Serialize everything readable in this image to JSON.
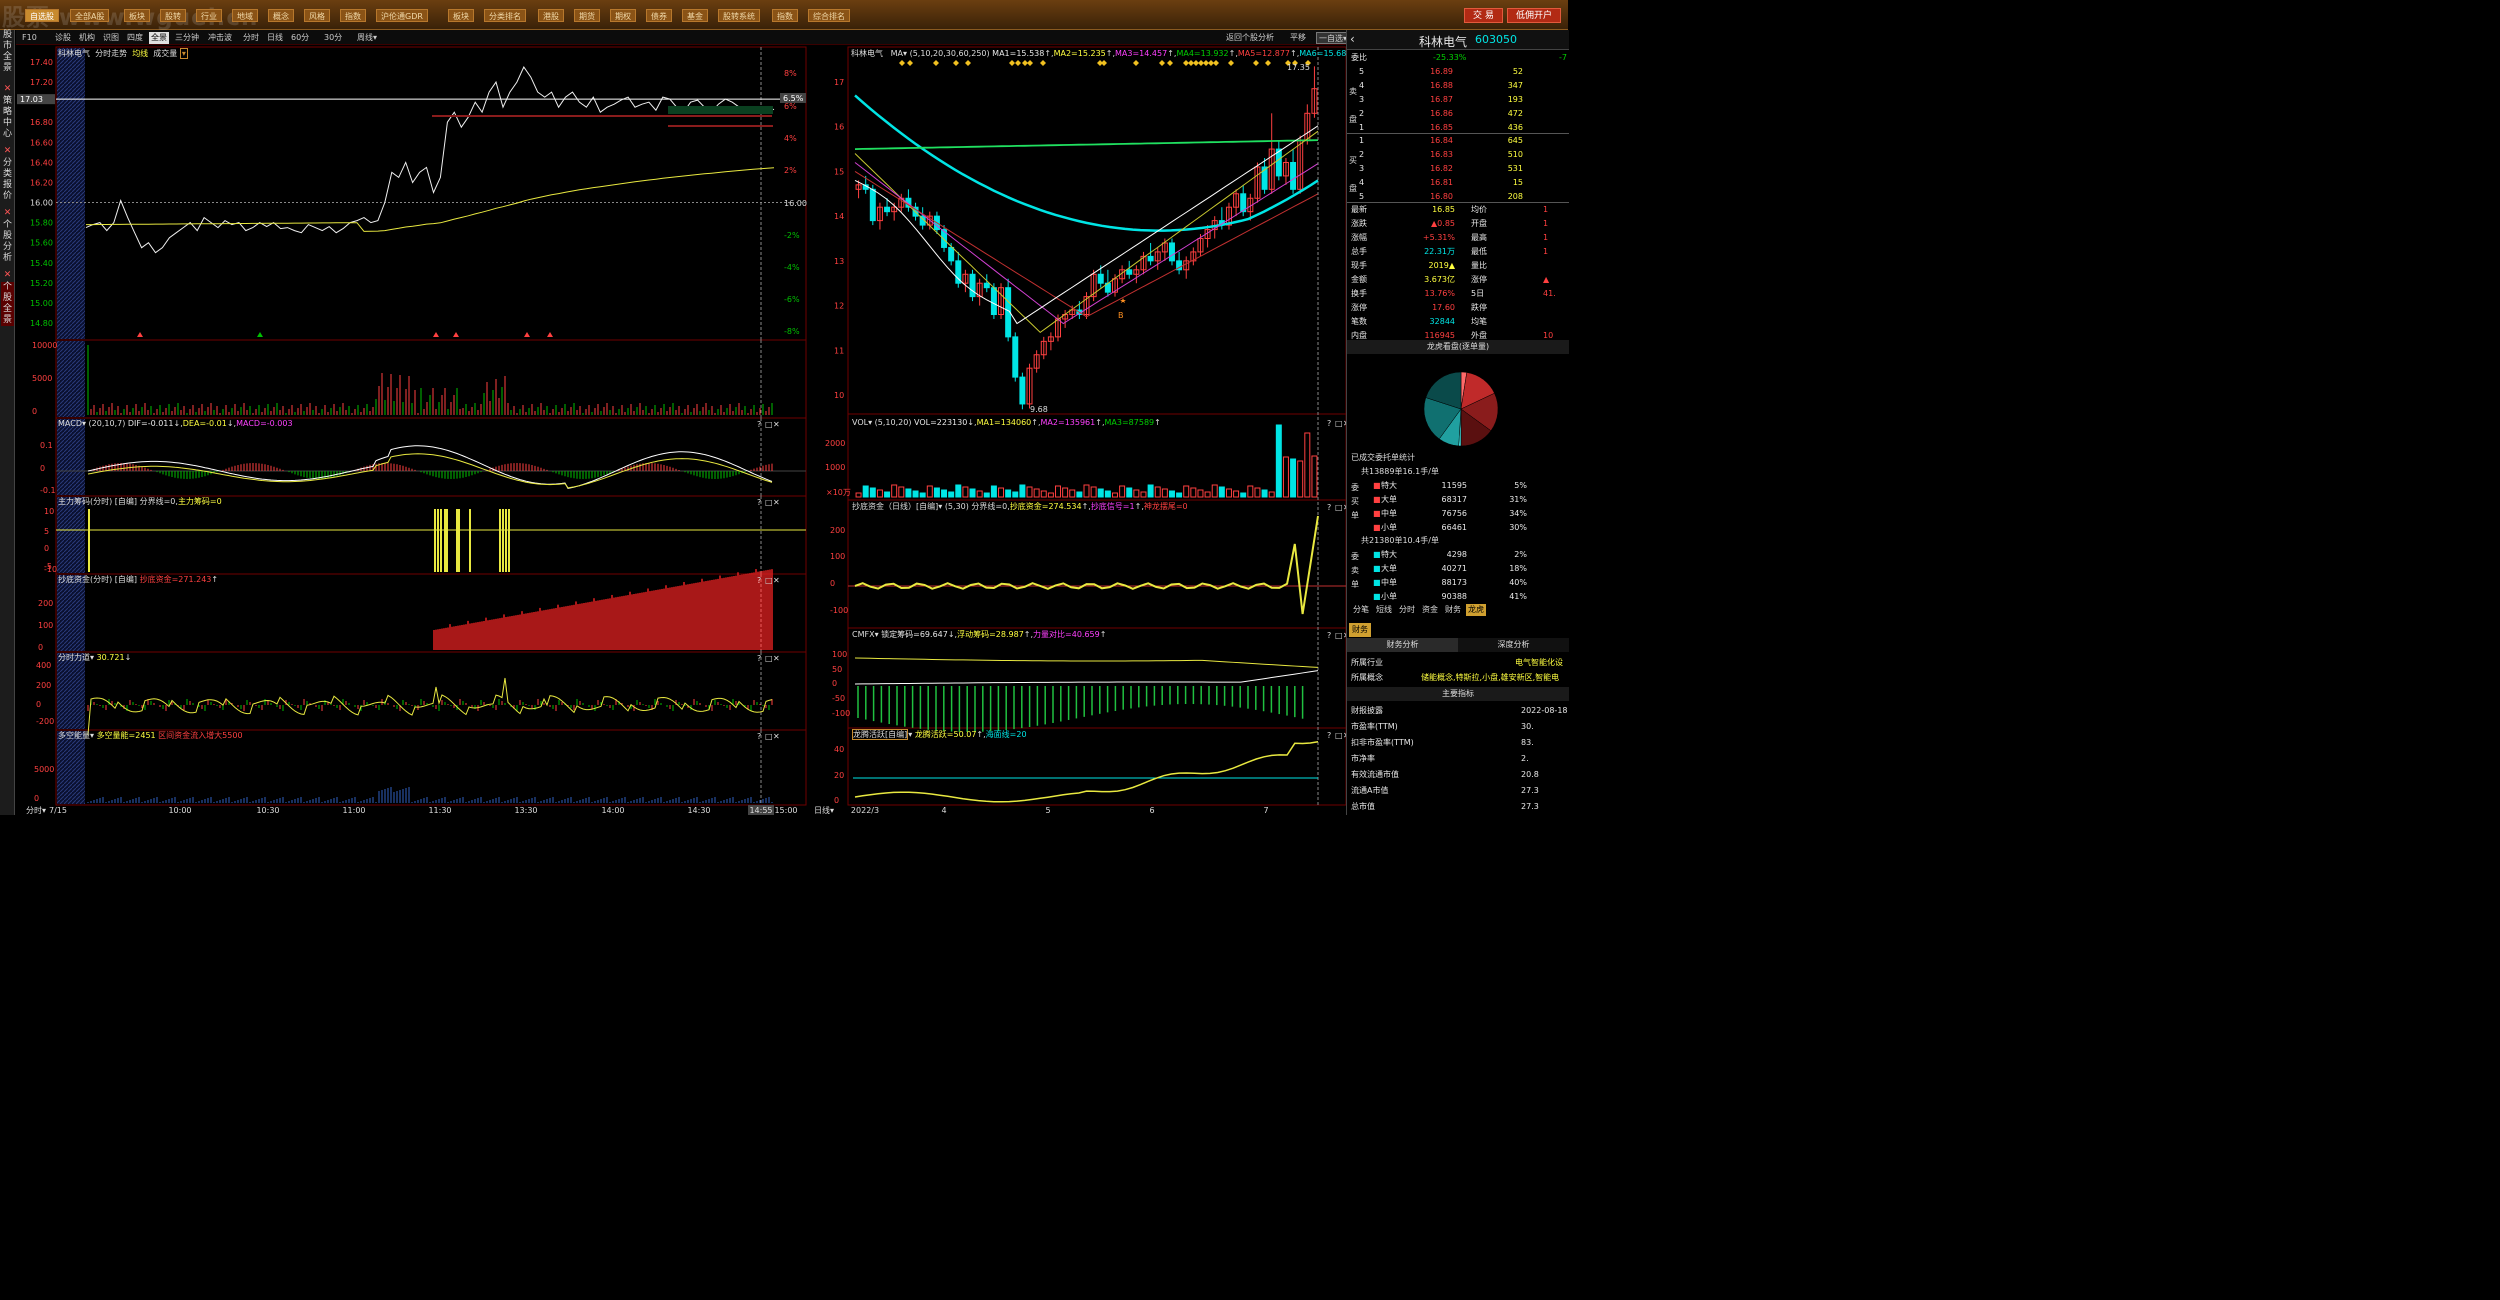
{
  "watermark": "股票 www.wguei.cn",
  "topnav": {
    "buttons": [
      "自选股",
      "全部A股",
      "板块",
      "股转",
      "行业",
      "地域",
      "概念",
      "风格",
      "指数",
      "沪伦通GDR",
      "板块",
      "分类排名",
      "港股",
      "期货",
      "期权",
      "债券",
      "基金",
      "股转系统",
      "指数",
      "综合排名"
    ],
    "trade": "交 易",
    "open_account": "低佣开户"
  },
  "sidebar": [
    "股市全景",
    "策略中心",
    "分类报价",
    "个股分析",
    "个股全景"
  ],
  "tabs": [
    "F10",
    "诊股",
    "机构",
    "识图",
    "四度",
    "全景",
    "三分钟",
    "冲击波",
    "分时",
    "日线",
    "60分",
    "30分",
    "周线▾"
  ],
  "tab_right": [
    "返回个股分析",
    "平移",
    "一自选▾"
  ],
  "intraday": {
    "title": "科林电气",
    "label": "分时走势",
    "avg": "均线",
    "vol": "成交量",
    "left_ticks": [
      "17.40",
      "17.20",
      "17.03",
      "16.80",
      "16.60",
      "16.40",
      "16.20",
      "16.00",
      "15.80",
      "15.60",
      "15.40",
      "15.20",
      "15.00",
      "14.80"
    ],
    "right_ticks": [
      "8%",
      "6.5%",
      "6%",
      "4%",
      "2%",
      "16.00",
      "-2%",
      "-4%",
      "-6%",
      "-8%"
    ],
    "price_series": [
      15.75,
      15.78,
      15.8,
      15.72,
      15.8,
      16.02,
      15.85,
      15.7,
      15.55,
      15.6,
      15.5,
      15.55,
      15.65,
      15.7,
      15.75,
      15.8,
      15.72,
      15.85,
      15.8,
      15.75,
      15.82,
      15.78,
      15.8,
      15.72,
      15.75,
      15.8,
      15.76,
      15.8,
      15.74,
      15.75,
      15.72,
      15.7,
      15.78,
      15.75,
      15.72,
      15.76,
      15.7,
      15.74,
      15.8,
      15.82,
      15.85,
      15.8,
      15.82,
      16.0,
      16.3,
      16.25,
      16.4,
      16.2,
      16.3,
      16.35,
      16.1,
      16.25,
      16.8,
      16.9,
      16.75,
      16.85,
      17.0,
      16.9,
      17.1,
      17.2,
      16.95,
      17.1,
      17.2,
      17.35,
      17.25,
      17.1,
      17.05,
      17.1,
      16.95,
      17.05,
      17.1,
      17.0,
      16.95,
      17.05,
      16.9,
      16.95,
      16.98,
      17.02,
      17.05,
      16.95,
      16.98,
      17.0,
      16.92,
      17.05,
      17.03,
      16.95,
      16.9,
      17.0,
      17.02,
      16.95,
      16.9,
      16.98,
      17.03,
      17.0,
      16.95,
      16.92,
      16.9,
      16.95,
      16.9,
      16.93
    ],
    "vol_ticks": [
      "10000",
      "5000",
      "0"
    ],
    "x_labels": [
      "7/15",
      "10:00",
      "10:30",
      "11:00",
      "11:30",
      "13:30",
      "14:00",
      "14:30",
      "14:55",
      "15:00"
    ],
    "tooltip": "14:55"
  },
  "macd": {
    "title": "MACD",
    "params": "(20,10,7)",
    "dif": "DIF=-0.011",
    "dea": "DEA=-0.01",
    "macd": "MACD=-0.003",
    "ticks": [
      "0.1",
      "0",
      "-0.1"
    ]
  },
  "main_chips": {
    "title": "主力筹码(分时)",
    "tag": "[自编]",
    "line": "分界线=0",
    "val": "主力筹码=0",
    "ticks": [
      "10",
      "5",
      "0",
      "-5",
      "-10"
    ]
  },
  "bottom_fund": {
    "title": "抄底资金(分时)",
    "tag": "[自编]",
    "val": "抄底资金=271.243",
    "ticks": [
      "200",
      "100",
      "0"
    ]
  },
  "strength": {
    "title": "分时力道",
    "val": "30.721",
    "ticks": [
      "400",
      "200",
      "0",
      "-200"
    ]
  },
  "multi": {
    "title": "多空能量",
    "val": "多空量能=2451",
    "val2": "区间资金流入增大5500",
    "ticks": [
      "5000",
      "0"
    ]
  },
  "daily": {
    "title": "科林电气",
    "ma": "MA",
    "ma_params": "(5,10,20,30,60,250)",
    "ma1": "MA1=15.538",
    "ma2": "MA2=15.235",
    "ma3": "MA3=14.457",
    "ma4": "MA4=13.932",
    "ma5": "MA5=12.877",
    "ma6": "MA6=15.68",
    "y_ticks": [
      "17",
      "16",
      "15",
      "14",
      "13",
      "12",
      "11",
      "10"
    ],
    "high_label": "17.35",
    "low_label": "9.68",
    "b_label": "B",
    "candles": [
      [
        14.6,
        14.8,
        14.4,
        14.7
      ],
      [
        14.7,
        14.9,
        14.5,
        14.6
      ],
      [
        14.6,
        14.7,
        13.8,
        13.9
      ],
      [
        13.9,
        14.3,
        13.7,
        14.2
      ],
      [
        14.2,
        14.4,
        14.0,
        14.1
      ],
      [
        14.1,
        14.3,
        13.9,
        14.2
      ],
      [
        14.2,
        14.5,
        14.1,
        14.4
      ],
      [
        14.4,
        14.6,
        14.1,
        14.2
      ],
      [
        14.2,
        14.3,
        13.9,
        14.0
      ],
      [
        14.0,
        14.2,
        13.7,
        13.8
      ],
      [
        13.8,
        14.1,
        13.7,
        14.0
      ],
      [
        14.0,
        14.1,
        13.6,
        13.7
      ],
      [
        13.7,
        13.8,
        13.2,
        13.3
      ],
      [
        13.3,
        13.4,
        12.9,
        13.0
      ],
      [
        13.0,
        13.2,
        12.4,
        12.5
      ],
      [
        12.5,
        12.8,
        12.3,
        12.7
      ],
      [
        12.7,
        12.8,
        12.1,
        12.2
      ],
      [
        12.2,
        12.6,
        12.0,
        12.5
      ],
      [
        12.5,
        12.7,
        12.3,
        12.4
      ],
      [
        12.4,
        12.5,
        11.7,
        11.8
      ],
      [
        11.8,
        12.5,
        11.7,
        12.4
      ],
      [
        12.4,
        12.6,
        11.2,
        11.3
      ],
      [
        11.3,
        11.4,
        10.3,
        10.4
      ],
      [
        10.4,
        10.5,
        9.68,
        9.8
      ],
      [
        9.8,
        10.7,
        9.7,
        10.6
      ],
      [
        10.6,
        11.0,
        10.5,
        10.9
      ],
      [
        10.9,
        11.3,
        10.8,
        11.2
      ],
      [
        11.2,
        11.4,
        11.0,
        11.3
      ],
      [
        11.3,
        11.8,
        11.2,
        11.7
      ],
      [
        11.7,
        11.9,
        11.5,
        11.8
      ],
      [
        11.8,
        12.0,
        11.7,
        11.9
      ],
      [
        11.9,
        12.1,
        11.7,
        11.8
      ],
      [
        11.8,
        12.3,
        11.7,
        12.2
      ],
      [
        12.2,
        12.8,
        12.1,
        12.7
      ],
      [
        12.7,
        12.9,
        12.4,
        12.5
      ],
      [
        12.5,
        12.8,
        12.2,
        12.3
      ],
      [
        12.3,
        12.7,
        12.2,
        12.6
      ],
      [
        12.6,
        12.9,
        12.5,
        12.8
      ],
      [
        12.8,
        13.0,
        12.6,
        12.7
      ],
      [
        12.7,
        12.9,
        12.5,
        12.8
      ],
      [
        12.8,
        13.2,
        12.7,
        13.1
      ],
      [
        13.1,
        13.4,
        12.9,
        13.0
      ],
      [
        13.0,
        13.3,
        12.8,
        13.2
      ],
      [
        13.2,
        13.5,
        13.0,
        13.4
      ],
      [
        13.4,
        13.5,
        12.9,
        13.0
      ],
      [
        13.0,
        13.2,
        12.7,
        12.8
      ],
      [
        12.8,
        13.1,
        12.6,
        13.0
      ],
      [
        13.0,
        13.3,
        12.9,
        13.2
      ],
      [
        13.2,
        13.6,
        13.1,
        13.5
      ],
      [
        13.5,
        13.8,
        13.3,
        13.7
      ],
      [
        13.7,
        14.0,
        13.5,
        13.9
      ],
      [
        13.9,
        14.2,
        13.7,
        13.8
      ],
      [
        13.8,
        14.3,
        13.7,
        14.2
      ],
      [
        14.2,
        14.6,
        14.0,
        14.5
      ],
      [
        14.5,
        14.7,
        14.0,
        14.1
      ],
      [
        14.1,
        14.5,
        13.9,
        14.4
      ],
      [
        14.4,
        15.2,
        14.3,
        15.1
      ],
      [
        15.1,
        15.3,
        14.5,
        14.6
      ],
      [
        14.6,
        16.3,
        14.5,
        15.5
      ],
      [
        15.5,
        15.7,
        14.8,
        14.9
      ],
      [
        14.9,
        15.3,
        14.7,
        15.2
      ],
      [
        15.2,
        15.5,
        14.5,
        14.6
      ],
      [
        14.6,
        15.8,
        14.5,
        15.7
      ],
      [
        15.7,
        16.5,
        15.6,
        16.3
      ],
      [
        16.3,
        17.35,
        16.2,
        16.85
      ]
    ],
    "x_labels": [
      "2022/3",
      "4",
      "5",
      "6",
      "7"
    ]
  },
  "vol_panel": {
    "title": "VOL",
    "params": "(5,10,20)",
    "vol": "VOL=223130",
    "ma1": "MA1=134060",
    "ma2": "MA2=135961",
    "ma3": "MA3=87589",
    "ticks": [
      "2000",
      "1000"
    ],
    "unit": "×10万"
  },
  "daily_fund": {
    "title": "抄底资金（日线）",
    "tag": "[自编]",
    "params": "(5,30)",
    "line": "分界线=0",
    "val": "抄底资金=274.534",
    "sig": "抄底信号=1",
    "dragon": "神龙摆尾=0",
    "ticks": [
      "200",
      "100",
      "0",
      "-100"
    ]
  },
  "cmfx": {
    "title": "CMFX",
    "lock": "锁定筹码=69.647",
    "float": "浮动筹码=28.987",
    "ratio": "力量对比=40.659",
    "ticks": [
      "100",
      "50",
      "0",
      "-50",
      "-100"
    ]
  },
  "dragon": {
    "title": "龙腾活跃",
    "tag": "[自编]",
    "val": "龙腾活跃=50.07",
    "sea": "海面线=20",
    "ticks": [
      "40",
      "20",
      "0"
    ]
  },
  "daily_bottom_label": "日线",
  "quote": {
    "name": "科林电气",
    "code": "603050",
    "wb_label": "委比",
    "wb_val": "-25.33%",
    "wb_val2": "-7",
    "asks": [
      [
        "5",
        "16.89",
        "52"
      ],
      [
        "4",
        "16.88",
        "347"
      ],
      [
        "3",
        "16.87",
        "193"
      ],
      [
        "2",
        "16.86",
        "472"
      ],
      [
        "1",
        "16.85",
        "436"
      ]
    ],
    "bids": [
      [
        "1",
        "16.84",
        "645"
      ],
      [
        "2",
        "16.83",
        "510"
      ],
      [
        "3",
        "16.82",
        "531"
      ],
      [
        "4",
        "16.81",
        "15"
      ],
      [
        "5",
        "16.80",
        "208"
      ]
    ],
    "ask_side": "卖盘",
    "bid_side": "买盘",
    "stats": [
      [
        "最新",
        "16.85",
        "均价",
        "1"
      ],
      [
        "涨跌",
        "▲0.85",
        "开盘",
        "1"
      ],
      [
        "涨幅",
        "+5.31%",
        "最高",
        "1"
      ],
      [
        "总手",
        "22.31万",
        "最低",
        "1"
      ],
      [
        "现手",
        "2019▲",
        "量比",
        ""
      ],
      [
        "金额",
        "3.673亿",
        "涨停",
        "▲"
      ],
      [
        "换手",
        "13.76%",
        "5日",
        "41."
      ],
      [
        "涨停",
        "17.60",
        "跌停",
        ""
      ],
      [
        "笔数",
        "32844",
        "均笔",
        ""
      ],
      [
        "内盘",
        "116945",
        "外盘",
        "10"
      ]
    ],
    "pie_title": "龙虎看盘(逐单量)",
    "pie_slices": [
      {
        "label": "特大卖",
        "value": 5,
        "color": "#ff6a6a"
      },
      {
        "label": "大卖",
        "value": 31,
        "color": "#c02a2a"
      },
      {
        "label": "中卖",
        "value": 34,
        "color": "#8a1c1c"
      },
      {
        "label": "小卖",
        "value": 30,
        "color": "#5a1010"
      }
    ],
    "order_title": "已成交委托单统计",
    "sell_total": "共13889单16.1手/单",
    "sell_rows": [
      [
        "特大",
        "11595",
        "5%"
      ],
      [
        "大单",
        "68317",
        "31%"
      ],
      [
        "中单",
        "76756",
        "34%"
      ],
      [
        "小单",
        "66461",
        "30%"
      ]
    ],
    "buy_total": "共21380单10.4手/单",
    "buy_rows": [
      [
        "特大",
        "4298",
        "2%"
      ],
      [
        "大单",
        "40271",
        "18%"
      ],
      [
        "中单",
        "88173",
        "40%"
      ],
      [
        "小单",
        "90388",
        "41%"
      ]
    ],
    "side_sell": [
      "委",
      "买",
      "单"
    ],
    "side_buy": [
      "委",
      "卖",
      "单"
    ],
    "bottom_tabs": [
      "分笔",
      "短线",
      "分时",
      "资金",
      "财务",
      "龙虎"
    ],
    "fin_tab": "财务",
    "fin_tabs": [
      "财务分析",
      "深度分析"
    ],
    "industry_label": "所属行业",
    "industry": "电气智能化设",
    "concept_label": "所属概念",
    "concept": "储能概念,特斯拉,小盘,雄安新区,智能电",
    "main_idx": "主要指标",
    "fin_rows": [
      [
        "财报披露",
        "2022-08-18"
      ],
      [
        "市盈率(TTM)",
        "30."
      ],
      [
        "扣非市盈率(TTM)",
        "83."
      ],
      [
        "市净率",
        "2."
      ],
      [
        "有效流通市值",
        "20.8"
      ],
      [
        "流通A市值",
        "27.3"
      ],
      [
        "总市值",
        "27.3"
      ]
    ]
  }
}
